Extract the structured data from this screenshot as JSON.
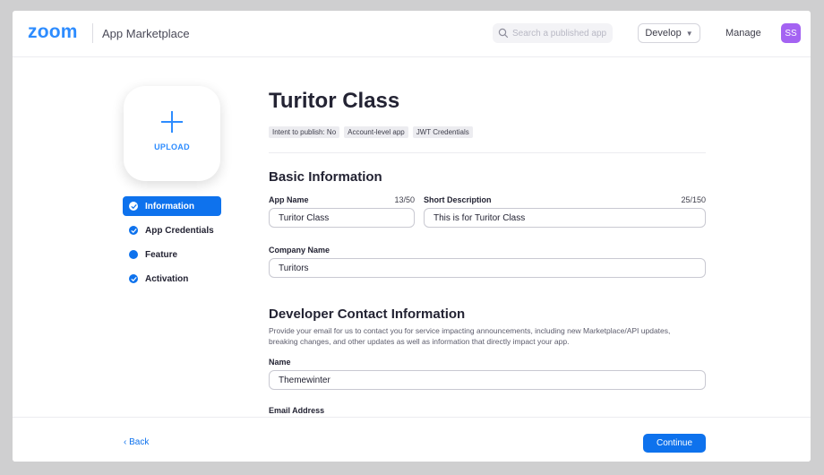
{
  "header": {
    "logo": "zoom",
    "product": "App Marketplace",
    "search_placeholder": "Search a published app",
    "develop_label": "Develop",
    "manage_label": "Manage",
    "avatar_initials": "SS"
  },
  "sidebar": {
    "upload_label": "UPLOAD",
    "items": [
      {
        "label": "Information",
        "state": "active-done"
      },
      {
        "label": "App Credentials",
        "state": "done"
      },
      {
        "label": "Feature",
        "state": "pending"
      },
      {
        "label": "Activation",
        "state": "done"
      }
    ]
  },
  "main": {
    "title": "Turitor Class",
    "tags": [
      "Intent to publish: No",
      "Account-level app",
      "JWT Credentials"
    ],
    "basic_info": {
      "title": "Basic Information",
      "app_name_label": "App Name",
      "app_name_count": "13/50",
      "app_name_value": "Turitor Class",
      "short_desc_label": "Short Description",
      "short_desc_count": "25/150",
      "short_desc_value": "This is for Turitor Class",
      "company_label": "Company Name",
      "company_value": "Turitors"
    },
    "developer_contact": {
      "title": "Developer Contact Information",
      "description": "Provide your email for us to contact you for service impacting announcements, including new Marketplace/API updates, breaking changes, and other updates as well as information that directly impact your app.",
      "name_label": "Name",
      "name_value": "Themewinter",
      "email_label": "Email Address"
    }
  },
  "footer": {
    "back_label": "Back",
    "continue_label": "Continue"
  },
  "colors": {
    "brand_blue": "#2d8cff",
    "primary_blue": "#0e72ed",
    "avatar_purple": "#a463f2"
  }
}
